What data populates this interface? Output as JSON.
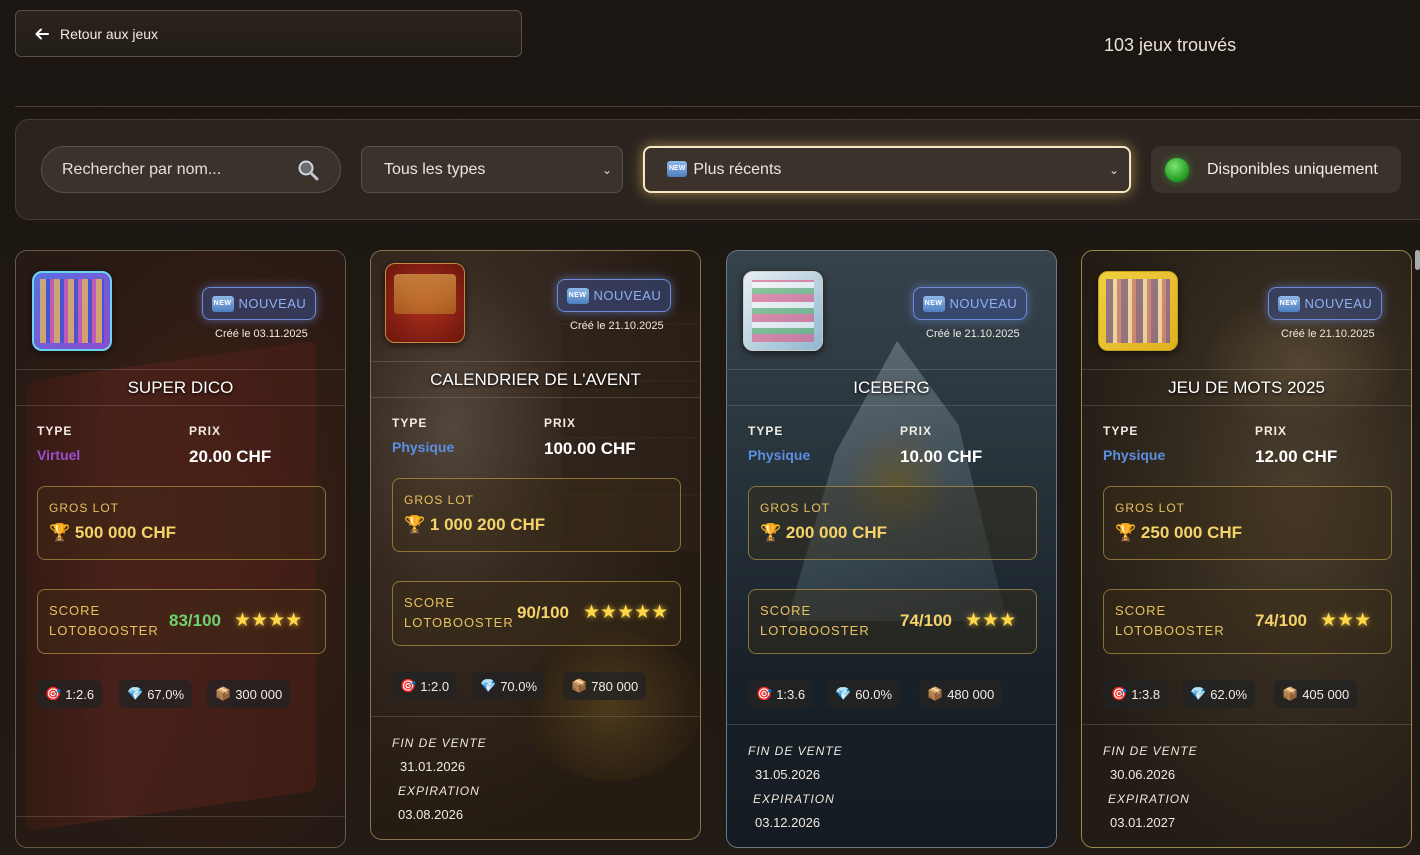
{
  "header": {
    "back_label": "Retour aux jeux",
    "count_text": "103 jeux trouvés"
  },
  "filters": {
    "search_placeholder": "Rechercher par nom...",
    "type_selected": "Tous les types",
    "sort_badge": "NEW",
    "sort_selected": "Plus récents",
    "available_label": "Disponibles uniquement"
  },
  "labels": {
    "type": "TYPE",
    "price": "PRIX",
    "jackpot": "GROS LOT",
    "score_line1": "SCORE",
    "score_line2": "LOTOBOOSTER",
    "sale_end": "FIN DE VENTE",
    "expiration": "EXPIRATION",
    "new_badge": "NEW",
    "nouveau": "NOUVEAU"
  },
  "colors": {
    "virtual": "#9a4fd0",
    "physical": "#5b8fdf",
    "score_green": "#6fd26f",
    "score_gold": "#f5d26a"
  },
  "cards": [
    {
      "title": "SUPER DICO",
      "created": "Créé le 03.11.2025",
      "type": "Virtuel",
      "price": "20.00 CHF",
      "jackpot": "500 000 CHF",
      "score": "83/100",
      "stars": "★★★★",
      "odds": "1:2.6",
      "payout": "67.0%",
      "tickets": "300 000",
      "sale_end": "",
      "expiration": ""
    },
    {
      "title": "CALENDRIER DE L'AVENT",
      "created": "Créé le 21.10.2025",
      "type": "Physique",
      "price": "100.00 CHF",
      "jackpot": "1 000 200 CHF",
      "score": "90/100",
      "stars": "★★★★★",
      "odds": "1:2.0",
      "payout": "70.0%",
      "tickets": "780 000",
      "sale_end": "31.01.2026",
      "expiration": "03.08.2026"
    },
    {
      "title": "ICEBERG",
      "created": "Créé le 21.10.2025",
      "type": "Physique",
      "price": "10.00 CHF",
      "jackpot": "200 000 CHF",
      "score": "74/100",
      "stars": "★★★",
      "odds": "1:3.6",
      "payout": "60.0%",
      "tickets": "480 000",
      "sale_end": "31.05.2026",
      "expiration": "03.12.2026"
    },
    {
      "title": "JEU DE MOTS 2025",
      "created": "Créé le 21.10.2025",
      "type": "Physique",
      "price": "12.00 CHF",
      "jackpot": "250 000 CHF",
      "score": "74/100",
      "stars": "★★★",
      "odds": "1:3.8",
      "payout": "62.0%",
      "tickets": "405 000",
      "sale_end": "30.06.2026",
      "expiration": "03.01.2027"
    }
  ]
}
